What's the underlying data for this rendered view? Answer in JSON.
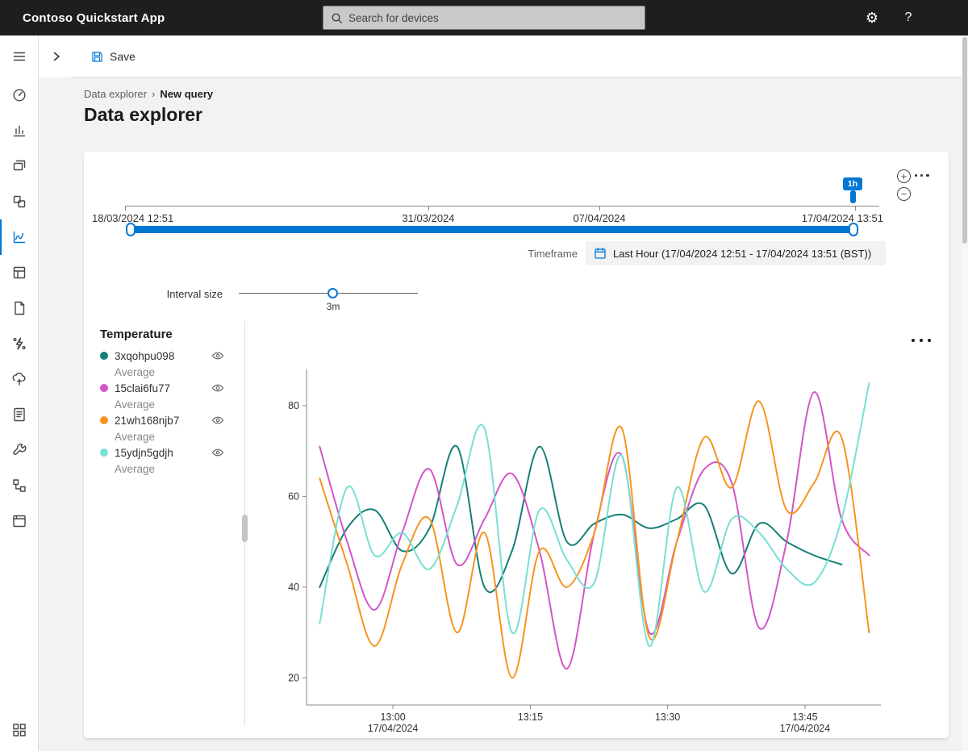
{
  "topbar": {
    "app_title": "Contoso Quickstart App",
    "search_placeholder": "Search for devices",
    "settings_glyph": "⚙",
    "help_glyph": "?"
  },
  "command_bar": {
    "save_label": "Save"
  },
  "breadcrumb": {
    "parent": "Data explorer",
    "separator": "›",
    "current": "New query"
  },
  "page": {
    "title": "Data explorer"
  },
  "sidebar": {
    "selected": "data-explorer",
    "items": [
      "menu",
      "dashboard",
      "analytics",
      "devices",
      "device-groups",
      "data-explorer",
      "jobs",
      "device-templates",
      "rules",
      "data-export",
      "audit-logs",
      "administration",
      "organizations",
      "customization"
    ],
    "bottom_item": "application-settings"
  },
  "time_slider": {
    "labels": [
      "18/03/2024 12:51",
      "31/03/2024",
      "07/04/2024",
      "17/04/2024 13:51"
    ],
    "selection_badge": "1h"
  },
  "timeframe": {
    "label": "Timeframe",
    "value": "Last Hour (17/04/2024 12:51 - 17/04/2024 13:51 (BST))"
  },
  "interval": {
    "label": "Interval size",
    "value": "3m"
  },
  "colors": {
    "accent": "#0078d4"
  },
  "chart_data": {
    "type": "line",
    "title": "Temperature",
    "xlabel": "",
    "ylabel": "",
    "yticks": [
      20,
      40,
      60,
      80
    ],
    "ylim": [
      14,
      88
    ],
    "x_minutes": [
      1,
      4,
      7,
      10,
      13,
      16,
      19,
      22,
      25,
      28,
      31,
      34,
      37,
      40,
      43,
      46,
      49,
      52,
      55,
      58,
      61
    ],
    "xticks": [
      {
        "label": "13:00",
        "sub": "17/04/2024",
        "t": 9
      },
      {
        "label": "13:15",
        "t": 24
      },
      {
        "label": "13:30",
        "t": 39
      },
      {
        "label": "13:45",
        "sub": "17/04/2024",
        "t": 54
      }
    ],
    "legend_position": "left",
    "series": [
      {
        "name": "3xqohpu098",
        "aggregate": "Average",
        "color": "#157f76",
        "values": [
          40,
          53,
          57,
          48,
          53,
          71,
          40,
          48,
          71,
          50,
          54,
          56,
          53,
          55,
          58,
          43,
          54,
          50,
          47,
          45,
          null
        ]
      },
      {
        "name": "15clai6fu77",
        "aggregate": "Average",
        "color": "#d356c5",
        "values": [
          71,
          50,
          35,
          52,
          66,
          45,
          55,
          65,
          48,
          22,
          52,
          69,
          30,
          50,
          66,
          63,
          31,
          50,
          83,
          55,
          47
        ]
      },
      {
        "name": "21wh168njb7",
        "aggregate": "Average",
        "color": "#f7941d",
        "values": [
          64,
          45,
          27,
          45,
          55,
          30,
          52,
          20,
          48,
          40,
          52,
          75,
          29,
          50,
          73,
          62,
          81,
          57,
          63,
          73,
          30
        ]
      },
      {
        "name": "15ydjn5gdjh",
        "aggregate": "Average",
        "color": "#78dfd3",
        "values": [
          32,
          62,
          47,
          52,
          44,
          58,
          75,
          30,
          57,
          46,
          41,
          69,
          27,
          62,
          39,
          55,
          52,
          44,
          41,
          55,
          85
        ]
      }
    ]
  }
}
